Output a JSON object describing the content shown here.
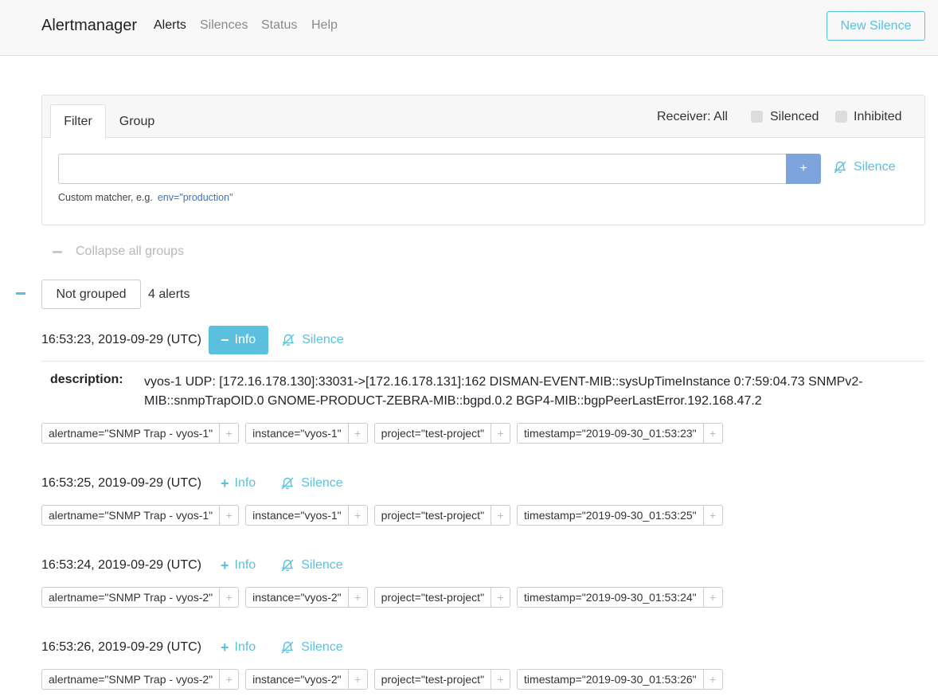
{
  "navbar": {
    "brand": "Alertmanager",
    "links": [
      "Alerts",
      "Silences",
      "Status",
      "Help"
    ],
    "new_silence": "New Silence"
  },
  "filter": {
    "tabs": [
      "Filter",
      "Group"
    ],
    "receiver": "Receiver: All",
    "silenced": "Silenced",
    "inhibited": "Inhibited",
    "input_value": "",
    "add_label": "+",
    "silence_label": "Silence",
    "hint": "Custom matcher, e.g.",
    "hint_example": "env=\"production\""
  },
  "collapse_all": "Collapse all groups",
  "group": {
    "label": "Not grouped",
    "count": "4 alerts"
  },
  "alerts": [
    {
      "timestamp": "16:53:23, 2019-09-29 (UTC)",
      "info": "Info",
      "silence": "Silence",
      "desc_key": "description:",
      "desc_value": "vyos-1 UDP: [172.16.178.130]:33031->[172.16.178.131]:162 DISMAN-EVENT-MIB::sysUpTimeInstance 0:7:59:04.73 SNMPv2-MIB::snmpTrapOID.0 GNOME-PRODUCT-ZEBRA-MIB::bgpd.0.2 BGP4-MIB::bgpPeerLastError.192.168.47.2",
      "labels": [
        "alertname=\"SNMP Trap - vyos-1\"",
        "instance=\"vyos-1\"",
        "project=\"test-project\"",
        "timestamp=\"2019-09-30_01:53:23\""
      ]
    },
    {
      "timestamp": "16:53:25, 2019-09-29 (UTC)",
      "info": "Info",
      "silence": "Silence",
      "labels": [
        "alertname=\"SNMP Trap - vyos-1\"",
        "instance=\"vyos-1\"",
        "project=\"test-project\"",
        "timestamp=\"2019-09-30_01:53:25\""
      ]
    },
    {
      "timestamp": "16:53:24, 2019-09-29 (UTC)",
      "info": "Info",
      "silence": "Silence",
      "labels": [
        "alertname=\"SNMP Trap - vyos-2\"",
        "instance=\"vyos-2\"",
        "project=\"test-project\"",
        "timestamp=\"2019-09-30_01:53:24\""
      ]
    },
    {
      "timestamp": "16:53:26, 2019-09-29 (UTC)",
      "info": "Info",
      "silence": "Silence",
      "labels": [
        "alertname=\"SNMP Trap - vyos-2\"",
        "instance=\"vyos-2\"",
        "project=\"test-project\"",
        "timestamp=\"2019-09-30_01:53:26\""
      ]
    }
  ],
  "label_add": "+",
  "colors": {
    "accent": "#5bc0de",
    "add_button": "#7ea4de",
    "link": "#3a74b8"
  },
  "icons": {
    "silence": "bell-slash-icon",
    "expand": "plus-icon",
    "collapse": "minus-icon"
  }
}
